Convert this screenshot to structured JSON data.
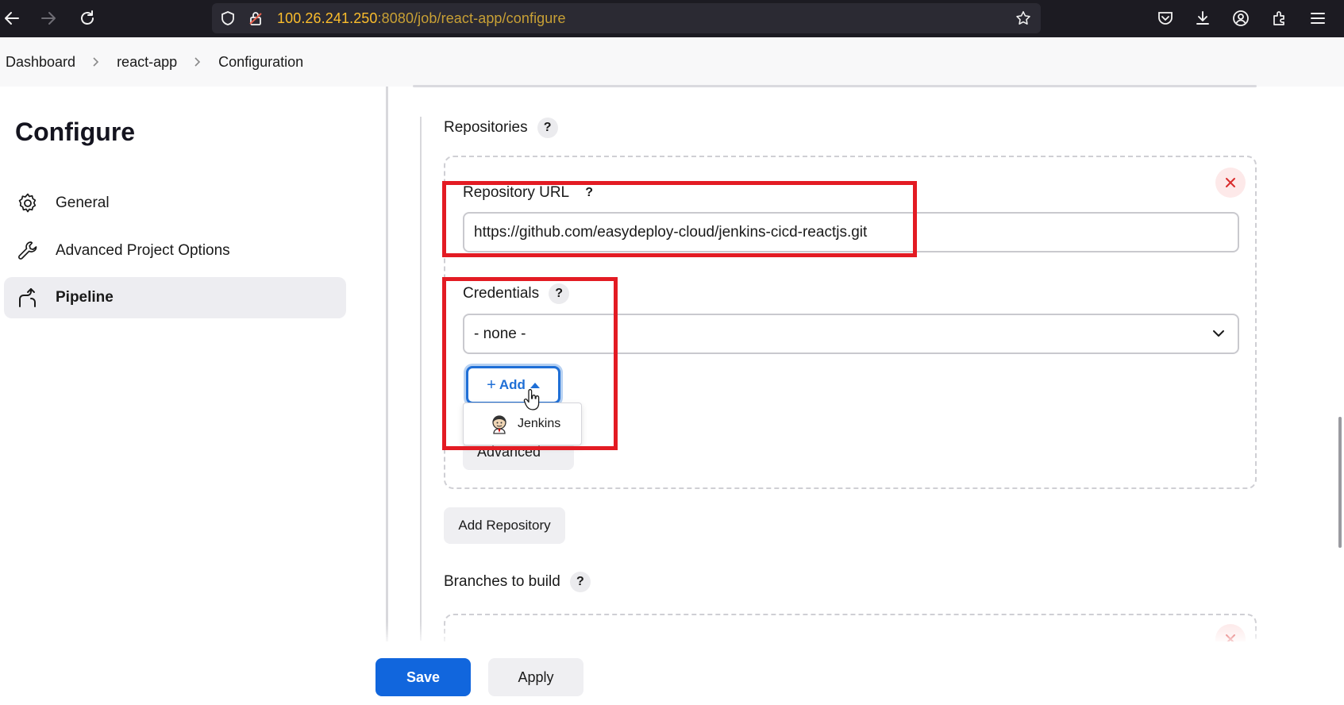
{
  "browser": {
    "url_host": "100.26.241.250",
    "url_path": ":8080/job/react-app/configure"
  },
  "breadcrumb": {
    "items": [
      "Dashboard",
      "react-app",
      "Configuration"
    ]
  },
  "sidebar": {
    "title": "Configure",
    "items": [
      {
        "label": "General",
        "icon": "gear-icon"
      },
      {
        "label": "Advanced Project Options",
        "icon": "wrench-icon"
      },
      {
        "label": "Pipeline",
        "icon": "pipeline-icon",
        "active": true
      }
    ]
  },
  "form": {
    "repositories_label": "Repositories",
    "help_glyph": "?",
    "repo_url_label": "Repository URL",
    "repo_url_value": "https://github.com/easydeploy-cloud/jenkins-cicd-reactjs.git",
    "credentials_label": "Credentials",
    "credentials_value": "- none -",
    "add_button_label": "Add",
    "add_button_plus": "+",
    "add_dropdown_items": [
      "Jenkins"
    ],
    "advanced_label": "Advanced",
    "add_repository_label": "Add Repository",
    "branches_label": "Branches to build"
  },
  "footer": {
    "save_label": "Save",
    "apply_label": "Apply"
  },
  "colors": {
    "highlight": "#e31b23",
    "primary": "#1166dd",
    "url_text": "#fbbd2c"
  }
}
